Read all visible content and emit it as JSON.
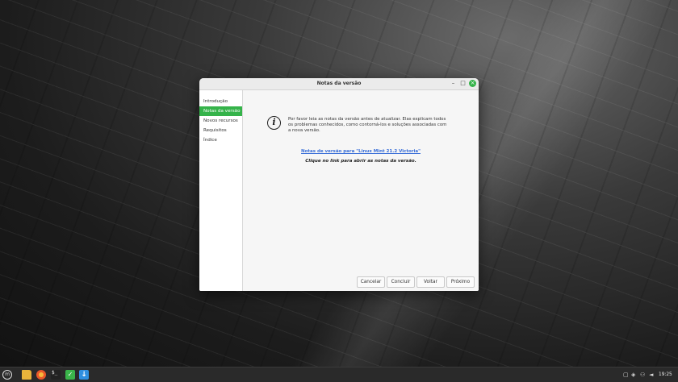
{
  "window": {
    "title": "Notas da versão",
    "controls": {
      "minimize": "–",
      "maximize": "□",
      "close": "×"
    }
  },
  "sidebar": {
    "items": [
      {
        "label": "Introdução",
        "active": false
      },
      {
        "label": "Notas da versão",
        "active": true
      },
      {
        "label": "Novos recursos",
        "active": false
      },
      {
        "label": "Requisitos",
        "active": false
      },
      {
        "label": "Índice",
        "active": false
      }
    ]
  },
  "content": {
    "icon": "info-icon",
    "icon_glyph": "i",
    "message": "Por favor leia as notas da versão antes de atualizar. Elas explicam todos os problemas conhecidos, como contorná-los e soluções associadas com a nova versão.",
    "link_text": "Notas de versão para \"Linux Mint 21.2 Victoria\"",
    "hint": "Clique no link para abrir as notas da versão."
  },
  "buttons": {
    "cancel": "Cancelar",
    "finish": "Concluir",
    "back": "Voltar",
    "next": "Próximo"
  },
  "taskbar": {
    "menu_icon": "mint-menu-icon",
    "terminal_glyph": "$_",
    "shield_glyph": "✓",
    "download_glyph": "↓",
    "clock": "19:25"
  },
  "colors": {
    "accent": "#35b34a",
    "link": "#3a6fd8"
  }
}
